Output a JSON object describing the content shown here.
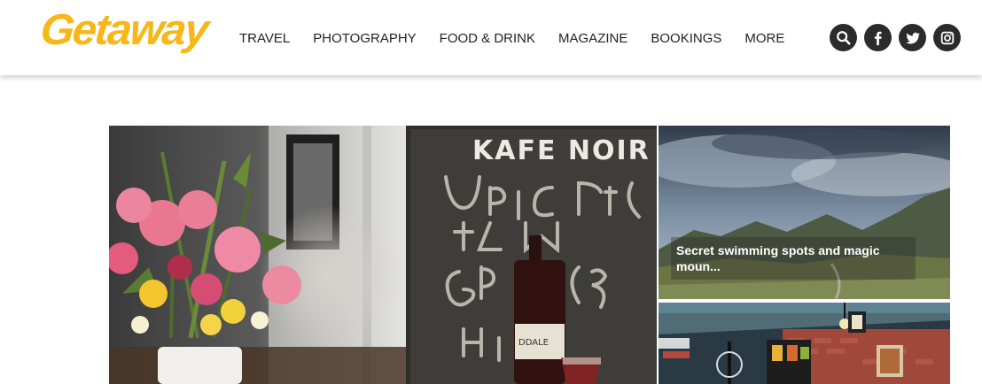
{
  "header": {
    "logo": "Getaway",
    "nav": [
      "TRAVEL",
      "PHOTOGRAPHY",
      "FOOD & DRINK",
      "MAGAZINE",
      "BOOKINGS",
      "MORE"
    ],
    "icons": [
      "search-icon",
      "facebook-icon",
      "twitter-icon",
      "instagram-icon"
    ]
  },
  "featured": {
    "main_image_sign": "KAFE NOIR",
    "side_story_1": "Secret swimming spots and magic moun..."
  },
  "colors": {
    "logo": "#f7b719",
    "icon_bg": "#2b2b2b"
  }
}
